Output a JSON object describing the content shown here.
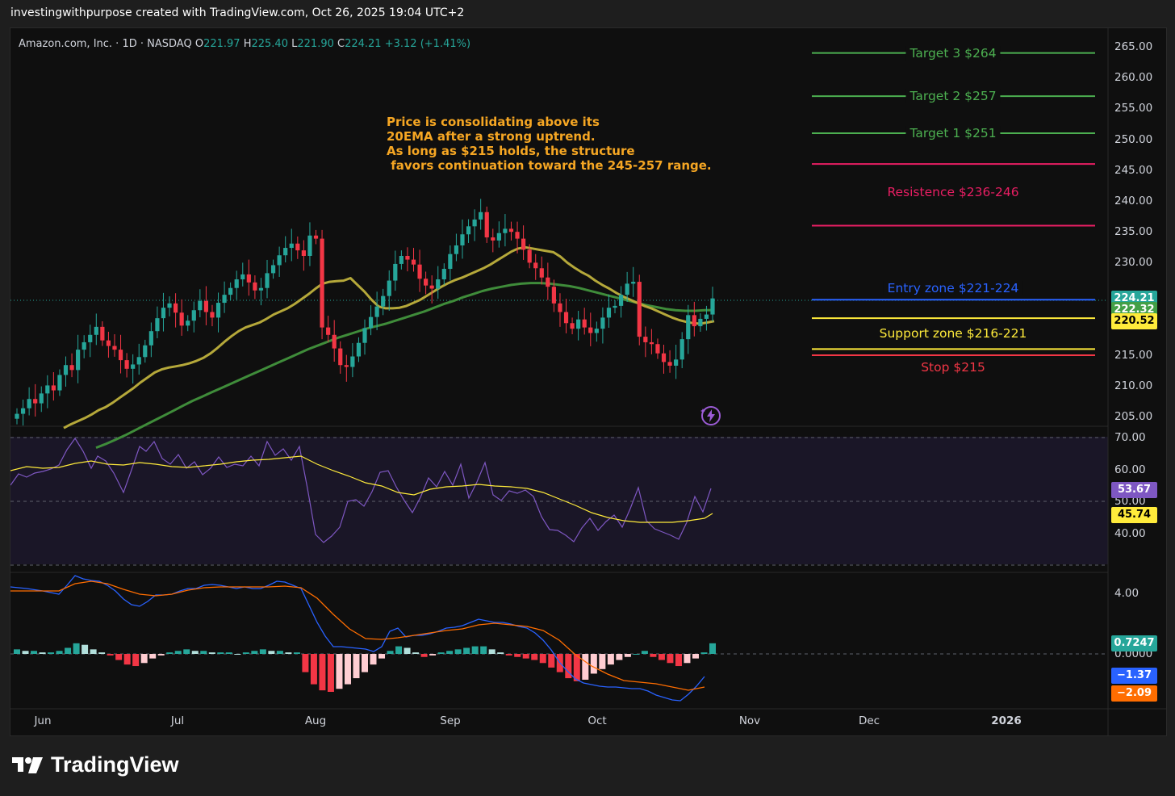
{
  "header": {
    "credit": "investingwithpurpose created with TradingView.com, Oct 26, 2025 19:04 UTC+2"
  },
  "legend": {
    "symbol": "Amazon.com, Inc. · 1D · NASDAQ",
    "o_label": "O",
    "o_value": "221.97",
    "h_label": "H",
    "h_value": "225.40",
    "l_label": "L",
    "l_value": "221.90",
    "c_label": "C",
    "c_value": "224.21",
    "change": "+3.12 (+1.41%)"
  },
  "annotation": {
    "text": "Price is consolidating above its\n20EMA after a strong uptrend.\nAs long as $215 holds, the structure\n favors continuation toward the 245-257 range."
  },
  "levels": [
    {
      "label": "Target 3 $264",
      "price": 264,
      "color": "#4caf50",
      "kind": "target"
    },
    {
      "label": "Target 2 $257",
      "price": 257,
      "color": "#4caf50",
      "kind": "target"
    },
    {
      "label": "Target 1 $251",
      "price": 251,
      "color": "#4caf50",
      "kind": "target"
    },
    {
      "label": "",
      "price": 246,
      "color": "#e91e63",
      "kind": "resistance-top"
    },
    {
      "label": "Resistence $236-246",
      "price": 241.5,
      "color": "#e91e63",
      "kind": "resistance-label"
    },
    {
      "label": "",
      "price": 236,
      "color": "#e91e63",
      "kind": "resistance-bottom"
    },
    {
      "label": "Entry zone $221-224",
      "price": 224,
      "color": "#2962ff",
      "kind": "entry"
    },
    {
      "label": "",
      "price": 221,
      "color": "#ffeb3b",
      "kind": "support-top"
    },
    {
      "label": "Support zone $216-221",
      "price": 218.5,
      "color": "#ffeb3b",
      "kind": "support-label"
    },
    {
      "label": "",
      "price": 216,
      "color": "#ffeb3b",
      "kind": "support-bottom"
    },
    {
      "label": "",
      "price": 215,
      "color": "#f23645",
      "kind": "stop-line"
    },
    {
      "label": "Stop $215",
      "price": 213,
      "color": "#f23645",
      "kind": "stop-label"
    }
  ],
  "price_axis": [
    "265.00",
    "260.00",
    "255.00",
    "250.00",
    "245.00",
    "240.00",
    "235.00",
    "230.00",
    "215.00",
    "210.00",
    "205.00"
  ],
  "price_badges": [
    {
      "value": "224.21",
      "price": 224.21,
      "bg": "#26a69a",
      "fg": "#ffffff"
    },
    {
      "value": "222.32",
      "price": 222.32,
      "bg": "#43a047",
      "fg": "#ffffff"
    },
    {
      "value": "220.52",
      "price": 220.52,
      "bg": "#ffeb3b",
      "fg": "#000000"
    }
  ],
  "rsi_axis": [
    "70.00",
    "60.00",
    "50.00",
    "40.00"
  ],
  "rsi_badges": [
    {
      "value": "53.67",
      "level": 53.67,
      "bg": "#7e57c2",
      "fg": "#ffffff"
    },
    {
      "value": "45.74",
      "level": 45.74,
      "bg": "#ffeb3b",
      "fg": "#000000"
    }
  ],
  "macd_axis": [
    "4.00",
    "0.0000"
  ],
  "macd_badges": [
    {
      "value": "0.7247",
      "level": 0,
      "bg": "#26a69a",
      "fg": "#ffffff"
    },
    {
      "value": "−1.37",
      "level": -1.37,
      "bg": "#2962ff",
      "fg": "#ffffff"
    },
    {
      "value": "−2.09",
      "level": -2.09,
      "bg": "#ff6d00",
      "fg": "#ffffff"
    }
  ],
  "time_axis": [
    {
      "label": "Jun",
      "bold": false
    },
    {
      "label": "Jul",
      "bold": false
    },
    {
      "label": "Aug",
      "bold": false
    },
    {
      "label": "Sep",
      "bold": false
    },
    {
      "label": "Oct",
      "bold": false
    },
    {
      "label": "Nov",
      "bold": false
    },
    {
      "label": "Dec",
      "bold": false
    },
    {
      "label": "2026",
      "bold": true
    }
  ],
  "brand": {
    "name": "TradingView"
  },
  "chart_data": {
    "type": "candlestick",
    "symbol": "Amazon.com, Inc.",
    "interval": "1D",
    "exchange": "NASDAQ",
    "price_range": [
      203,
      268
    ],
    "close": [
      205.5,
      206.4,
      207.9,
      207.2,
      208.8,
      210.1,
      209.3,
      211.8,
      213.4,
      212.6,
      215.9,
      217.1,
      218.3,
      219.6,
      217.4,
      216.5,
      215.9,
      214.2,
      212.8,
      213.5,
      214.7,
      216.6,
      218.9,
      221.0,
      222.7,
      223.4,
      221.9,
      219.8,
      220.6,
      222.3,
      223.8,
      222.0,
      221.1,
      223.5,
      224.8,
      225.9,
      227.3,
      228.1,
      226.8,
      225.5,
      225.9,
      228.3,
      229.6,
      231.2,
      232.4,
      233.1,
      232.0,
      231.1,
      234.4,
      233.9,
      219.5,
      218.3,
      216.1,
      213.4,
      213.1,
      214.8,
      217.0,
      219.4,
      221.2,
      222.9,
      224.6,
      227.1,
      229.8,
      231.1,
      230.5,
      229.7,
      227.4,
      226.3,
      225.8,
      227.3,
      229.0,
      231.4,
      232.8,
      234.6,
      235.9,
      237.0,
      238.2,
      234.1,
      233.6,
      234.8,
      235.5,
      235.0,
      233.9,
      232.1,
      230.0,
      229.1,
      227.6,
      226.1,
      223.4,
      222.0,
      220.2,
      219.3,
      220.8,
      219.5,
      218.6,
      219.3,
      221.1,
      222.7,
      223.0,
      224.8,
      226.6,
      226.9,
      218.0,
      217.1,
      216.8,
      215.3,
      213.9,
      213.3,
      214.3,
      217.6,
      221.5,
      219.7,
      220.9,
      221.6,
      224.21
    ],
    "ema20": [
      203.2,
      203.8,
      204.3,
      204.8,
      205.4,
      206.1,
      206.6,
      207.3,
      208.1,
      208.9,
      209.7,
      210.6,
      211.4,
      212.2,
      212.7,
      213.0,
      213.2,
      213.4,
      213.7,
      214.1,
      214.6,
      215.3,
      216.2,
      217.2,
      218.1,
      218.9,
      219.5,
      219.9,
      220.3,
      220.9,
      221.6,
      222.1,
      222.6,
      223.3,
      224.1,
      224.9,
      225.8,
      226.6,
      226.9,
      227.0,
      227.1,
      227.5,
      226.4,
      225.3,
      224.0,
      222.9,
      222.6,
      222.6,
      222.7,
      223.0,
      223.5,
      224.0,
      224.7,
      225.4,
      226.1,
      226.7,
      227.2,
      227.6,
      228.1,
      228.6,
      229.1,
      229.7,
      230.4,
      231.1,
      231.8,
      232.3,
      232.5,
      232.3,
      232.1,
      231.9,
      231.7,
      231.0,
      230.0,
      229.2,
      228.5,
      227.9,
      227.1,
      226.4,
      225.8,
      225.1,
      224.5,
      224.0,
      223.5,
      223.0,
      222.6,
      222.1,
      221.6,
      221.1,
      220.7,
      220.4,
      220.2,
      220.1,
      220.3,
      220.52
    ],
    "ema50": [
      200.0,
      200.6,
      201.3,
      202.0,
      202.8,
      203.6,
      204.4,
      205.2,
      206.0,
      206.8,
      207.6,
      208.3,
      209.0,
      209.7,
      210.4,
      211.1,
      211.8,
      212.5,
      213.2,
      213.9,
      214.6,
      215.3,
      216.0,
      216.6,
      217.2,
      217.8,
      218.3,
      218.8,
      219.3,
      219.7,
      220.1,
      220.6,
      221.1,
      221.6,
      222.1,
      222.7,
      223.3,
      223.8,
      224.4,
      224.9,
      225.4,
      225.8,
      226.1,
      226.4,
      226.6,
      226.7,
      226.7,
      226.6,
      226.4,
      226.2,
      225.9,
      225.5,
      225.1,
      224.7,
      224.3,
      223.9,
      223.5,
      223.1,
      222.8,
      222.5,
      222.3,
      222.2,
      222.2,
      222.3,
      222.32
    ]
  }
}
